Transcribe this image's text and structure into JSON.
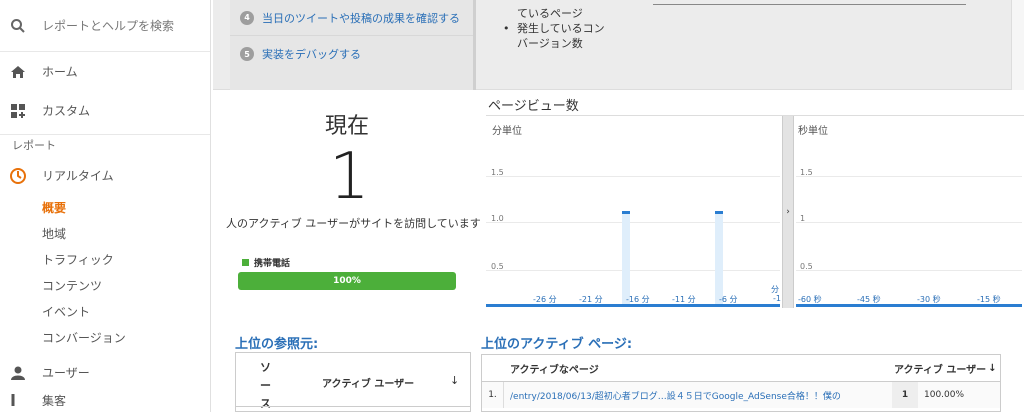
{
  "sidebar": {
    "search_placeholder": "レポートとヘルプを検索",
    "home": "ホーム",
    "custom": "カスタム",
    "reports_header": "レポート",
    "realtime": "リアルタイム",
    "sub_items": [
      "概要",
      "地域",
      "トラフィック",
      "コンテンツ",
      "イベント",
      "コンバージョン"
    ],
    "users": "ユーザー",
    "acquisition_partial": "集客"
  },
  "steps": [
    {
      "num": "4",
      "text": "当日のツイートや投稿の成果を確認する"
    },
    {
      "num": "5",
      "text": "実装をデバッグする"
    }
  ],
  "bullets": {
    "line0": "ているページ",
    "item": "発生しているコン",
    "item_cont": "バージョン数"
  },
  "now": {
    "title": "現在",
    "value": "1",
    "caption": "人のアクティブ ユーザーがサイトを訪問しています",
    "legend": "携帯電話",
    "percent": "100%",
    "percent_value": 100
  },
  "chart": {
    "title": "ページビュー数",
    "left_label": "分単位",
    "right_label": "秒単位",
    "y_ticks": [
      "1.5",
      "1.0",
      "0.5"
    ],
    "right_y_ticks": [
      "1.5",
      "1",
      "0.5"
    ],
    "x_ticks_min": [
      "-26 分",
      "-21 分",
      "-16 分",
      "-11 分",
      "-6 分"
    ],
    "x_tick_last_top": "分",
    "x_tick_last_bottom": "-1",
    "x_ticks_sec": [
      "-60 秒",
      "-45 秒",
      "-30 秒",
      "-15 秒"
    ],
    "splitter_arrow": "›"
  },
  "chart_data": {
    "type": "bar",
    "ylim": [
      0,
      1.5
    ],
    "series": [
      {
        "name": "分単位",
        "x": [
          -17,
          -7
        ],
        "values": [
          1,
          1
        ]
      }
    ]
  },
  "referrals": {
    "title": "上位の参照元:",
    "col_source": "ソース",
    "col_active": "アクティブ ユーザー",
    "sort_arrow": "↓"
  },
  "active_pages": {
    "title": "上位のアクティブ ページ:",
    "col_page": "アクティブなページ",
    "col_users": "アクティブ ユーザー",
    "sort_arrow": "↓",
    "rows": [
      {
        "idx": "1.",
        "page": "/entry/2018/06/13/超初心者ブログ…設４５日でGoogle_AdSense合格！！僕の",
        "count": "1",
        "pct": "100.00%"
      }
    ]
  }
}
